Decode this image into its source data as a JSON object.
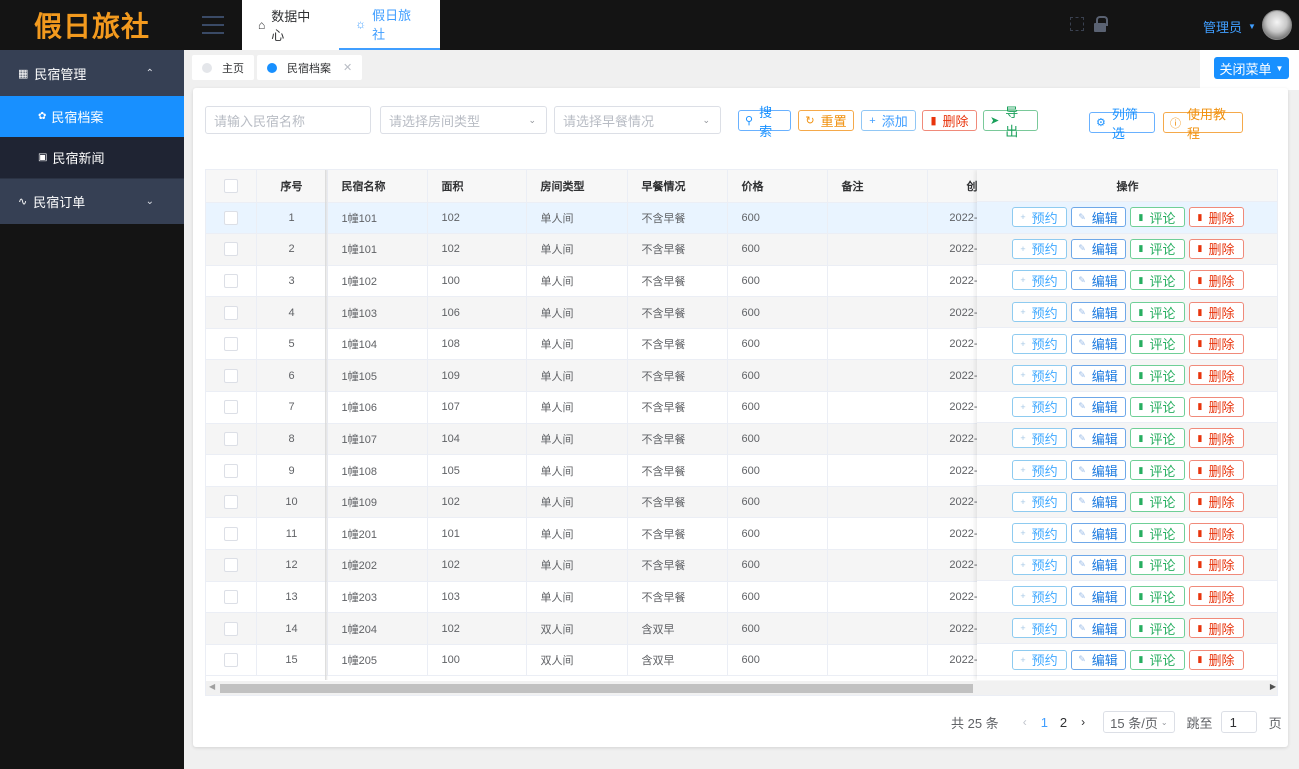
{
  "header": {
    "logo": "假日旅社",
    "nav": [
      {
        "label": "数据中心",
        "icon": "home-icon",
        "active": false
      },
      {
        "label": "假日旅社",
        "icon": "bulb-icon",
        "active": true
      }
    ],
    "user": "管理员"
  },
  "sidebar": {
    "groups": [
      {
        "label": "民宿管理",
        "icon": "grid-icon",
        "expanded": true,
        "items": [
          {
            "label": "民宿档案",
            "icon": "settings-icon",
            "active": true
          },
          {
            "label": "民宿新闻",
            "icon": "news-icon",
            "active": false
          }
        ]
      },
      {
        "label": "民宿订单",
        "icon": "pulse-icon",
        "expanded": false,
        "items": []
      }
    ]
  },
  "tags": {
    "items": [
      {
        "label": "主页",
        "active": false
      },
      {
        "label": "民宿档案",
        "active": true,
        "closable": true
      }
    ],
    "close_menu": "关闭菜单"
  },
  "filters": {
    "name_placeholder": "请输入民宿名称",
    "room_type_placeholder": "请选择房间类型",
    "breakfast_placeholder": "请选择早餐情况"
  },
  "toolbar": {
    "search": "搜索",
    "reset": "重置",
    "add": "添加",
    "delete": "删除",
    "export": "导出",
    "columns": "列筛选",
    "tutorial": "使用教程"
  },
  "table": {
    "columns": [
      "序号",
      "民宿名称",
      "面积",
      "房间类型",
      "早餐情况",
      "价格",
      "备注",
      "创",
      "操作"
    ],
    "actions": [
      "预约",
      "编辑",
      "评论",
      "删除"
    ],
    "rows": [
      {
        "idx": "1",
        "name": "1幢101",
        "area": "102",
        "type": "单人间",
        "breakfast": "不含早餐",
        "price": "600",
        "note": "",
        "created": "2022-"
      },
      {
        "idx": "2",
        "name": "1幢101",
        "area": "102",
        "type": "单人间",
        "breakfast": "不含早餐",
        "price": "600",
        "note": "",
        "created": "2022-"
      },
      {
        "idx": "3",
        "name": "1幢102",
        "area": "100",
        "type": "单人间",
        "breakfast": "不含早餐",
        "price": "600",
        "note": "",
        "created": "2022-"
      },
      {
        "idx": "4",
        "name": "1幢103",
        "area": "106",
        "type": "单人间",
        "breakfast": "不含早餐",
        "price": "600",
        "note": "",
        "created": "2022-"
      },
      {
        "idx": "5",
        "name": "1幢104",
        "area": "108",
        "type": "单人间",
        "breakfast": "不含早餐",
        "price": "600",
        "note": "",
        "created": "2022-"
      },
      {
        "idx": "6",
        "name": "1幢105",
        "area": "109",
        "type": "单人间",
        "breakfast": "不含早餐",
        "price": "600",
        "note": "",
        "created": "2022-"
      },
      {
        "idx": "7",
        "name": "1幢106",
        "area": "107",
        "type": "单人间",
        "breakfast": "不含早餐",
        "price": "600",
        "note": "",
        "created": "2022-"
      },
      {
        "idx": "8",
        "name": "1幢107",
        "area": "104",
        "type": "单人间",
        "breakfast": "不含早餐",
        "price": "600",
        "note": "",
        "created": "2022-"
      },
      {
        "idx": "9",
        "name": "1幢108",
        "area": "105",
        "type": "单人间",
        "breakfast": "不含早餐",
        "price": "600",
        "note": "",
        "created": "2022-"
      },
      {
        "idx": "10",
        "name": "1幢109",
        "area": "102",
        "type": "单人间",
        "breakfast": "不含早餐",
        "price": "600",
        "note": "",
        "created": "2022-"
      },
      {
        "idx": "11",
        "name": "1幢201",
        "area": "101",
        "type": "单人间",
        "breakfast": "不含早餐",
        "price": "600",
        "note": "",
        "created": "2022-"
      },
      {
        "idx": "12",
        "name": "1幢202",
        "area": "102",
        "type": "单人间",
        "breakfast": "不含早餐",
        "price": "600",
        "note": "",
        "created": "2022-"
      },
      {
        "idx": "13",
        "name": "1幢203",
        "area": "103",
        "type": "单人间",
        "breakfast": "不含早餐",
        "price": "600",
        "note": "",
        "created": "2022-"
      },
      {
        "idx": "14",
        "name": "1幢204",
        "area": "102",
        "type": "双人间",
        "breakfast": "含双早",
        "price": "600",
        "note": "",
        "created": "2022-"
      },
      {
        "idx": "15",
        "name": "1幢205",
        "area": "100",
        "type": "双人间",
        "breakfast": "含双早",
        "price": "600",
        "note": "",
        "created": "2022-"
      }
    ]
  },
  "pagination": {
    "total": "共 25 条",
    "pages": [
      "1",
      "2"
    ],
    "current": "1",
    "page_size": "15 条/页",
    "jump_label": "跳至",
    "jump_value": "1",
    "page_suffix": "页"
  },
  "colors": {
    "primary": "#1890ff",
    "logo": "#f39a1e",
    "danger": "#e8340c",
    "success": "#27ae60",
    "warning": "#f0900d"
  }
}
